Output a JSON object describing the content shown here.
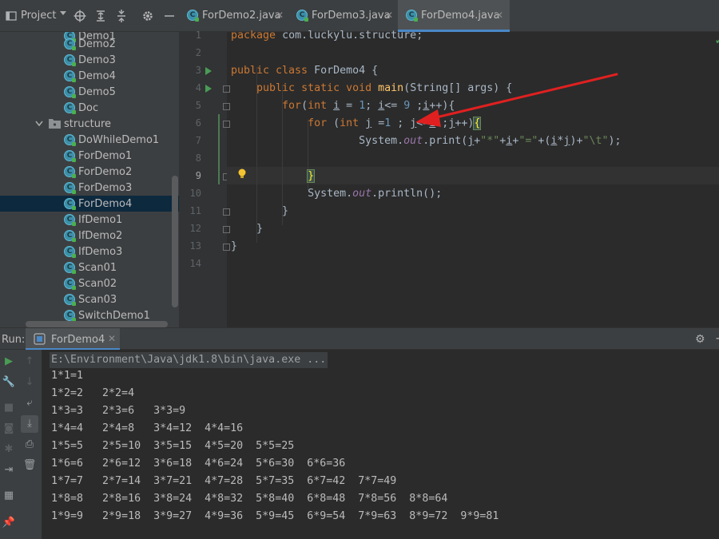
{
  "project": {
    "label": "Project"
  },
  "tree": {
    "items_top": [
      "Demo1",
      "Demo2",
      "Demo3",
      "Demo4",
      "Demo5",
      "Doc"
    ],
    "folder": "structure",
    "items_structure": [
      "DoWhileDemo1",
      "ForDemo1",
      "ForDemo2",
      "ForDemo3",
      "ForDemo4",
      "IfDemo1",
      "IfDemo2",
      "IfDemo3",
      "Scan01",
      "Scan02",
      "Scan03",
      "SwitchDemo1"
    ],
    "selected": "ForDemo4"
  },
  "tabs": [
    "ForDemo2.java",
    "ForDemo3.java",
    "ForDemo4.java"
  ],
  "active_tab": "ForDemo4.java",
  "editor": {
    "line_numbers": [
      "1",
      "2",
      "3",
      "4",
      "5",
      "6",
      "7",
      "8",
      "9",
      "10",
      "11",
      "12",
      "13",
      "14"
    ],
    "package_line": "com.luckylu.structure",
    "class_name": "ForDemo4"
  },
  "run": {
    "label": "Run:",
    "tab": "ForDemo4",
    "command": "E:\\Environment\\Java\\jdk1.8\\bin\\java.exe ...",
    "output": [
      "1*1=1",
      "1*2=2   2*2=4",
      "1*3=3   2*3=6   3*3=9",
      "1*4=4   2*4=8   3*4=12  4*4=16",
      "1*5=5   2*5=10  3*5=15  4*5=20  5*5=25",
      "1*6=6   2*6=12  3*6=18  4*6=24  5*6=30  6*6=36",
      "1*7=7   2*7=14  3*7=21  4*7=28  5*7=35  6*7=42  7*7=49",
      "1*8=8   2*8=16  3*8=24  4*8=32  5*8=40  6*8=48  7*8=56  8*8=64",
      "1*9=9   2*9=18  3*9=27  4*9=36  5*9=45  6*9=54  7*9=63  8*9=72  9*9=81"
    ]
  },
  "colors": {
    "accent": "#4a88c7",
    "arrow": "#e02020",
    "run_green": "#499c54"
  }
}
